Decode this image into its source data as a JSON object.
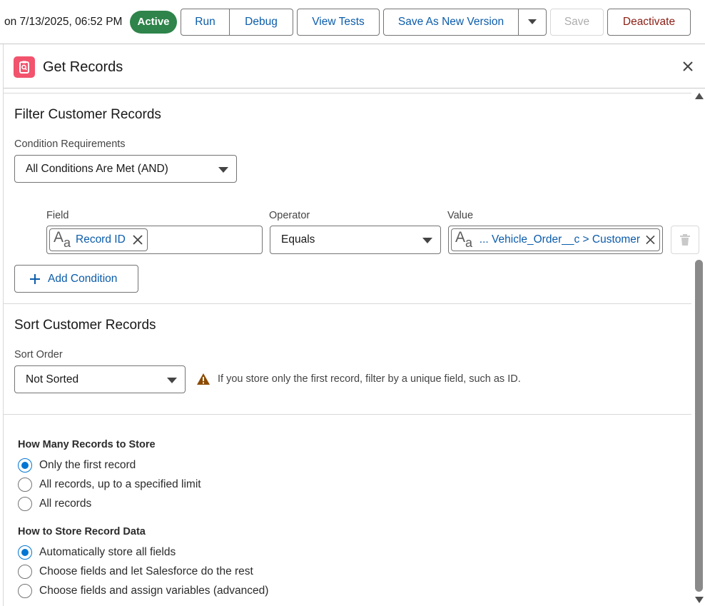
{
  "toolbar": {
    "date_text": "on 7/13/2025, 06:52 PM",
    "status_badge": "Active",
    "run": "Run",
    "debug": "Debug",
    "view_tests": "View Tests",
    "save_as_new_version": "Save As New Version",
    "save": "Save",
    "deactivate": "Deactivate"
  },
  "panel": {
    "title": "Get Records",
    "icon": "get-records-icon",
    "close_icon": "close-icon"
  },
  "filter": {
    "title": "Filter Customer Records",
    "condition_requirements_label": "Condition Requirements",
    "condition_requirements_value": "All Conditions Are Met (AND)",
    "field_label": "Field",
    "operator_label": "Operator",
    "value_label": "Value",
    "field_value": "Record ID",
    "operator_value": "Equals",
    "value_value": "... Vehicle_Order__c > Customer",
    "add_condition": "Add Condition"
  },
  "sort": {
    "title": "Sort Customer Records",
    "sort_order_label": "Sort Order",
    "sort_order_value": "Not Sorted",
    "warning": "If you store only the first record, filter by a unique field, such as ID."
  },
  "store_count": {
    "label": "How Many Records to Store",
    "options": [
      "Only the first record",
      "All records, up to a specified limit",
      "All records"
    ],
    "selected": "Only the first record"
  },
  "store_data": {
    "label": "How to Store Record Data",
    "options": [
      "Automatically store all fields",
      "Choose fields and let Salesforce do the rest",
      "Choose fields and assign variables (advanced)"
    ],
    "selected": "Automatically store all fields"
  },
  "colors": {
    "brand_blue": "#0b5cab",
    "active_green": "#2e844a",
    "deactivate_red": "#8c1c13",
    "radio_blue": "#0176d3",
    "get_records_pink": "#f2536d",
    "warning_amber": "#8c4b02"
  }
}
